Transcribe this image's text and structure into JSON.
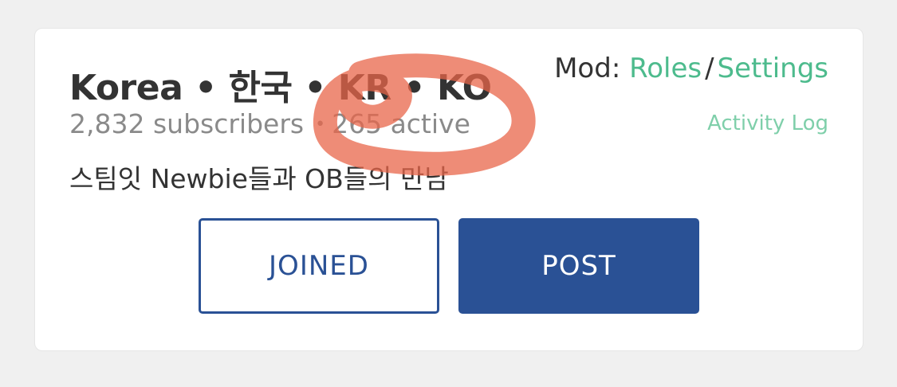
{
  "community": {
    "title": "Korea • 한국 • KR • KO",
    "subscribers": "2,832 subscribers",
    "separator": "•",
    "active": "265 active",
    "tagline": "스팀잇 Newbie들과 OB들의 만남"
  },
  "moderation": {
    "prefix": "Mod:",
    "roles_label": "Roles",
    "divider": "/",
    "settings_label": "Settings",
    "activity_log_label": "Activity Log"
  },
  "actions": {
    "joined_label": "JOINED",
    "post_label": "POST"
  },
  "colors": {
    "accent_green": "#4dbb8d",
    "primary_blue": "#2a5195",
    "annotation_red": "#e8654a"
  }
}
